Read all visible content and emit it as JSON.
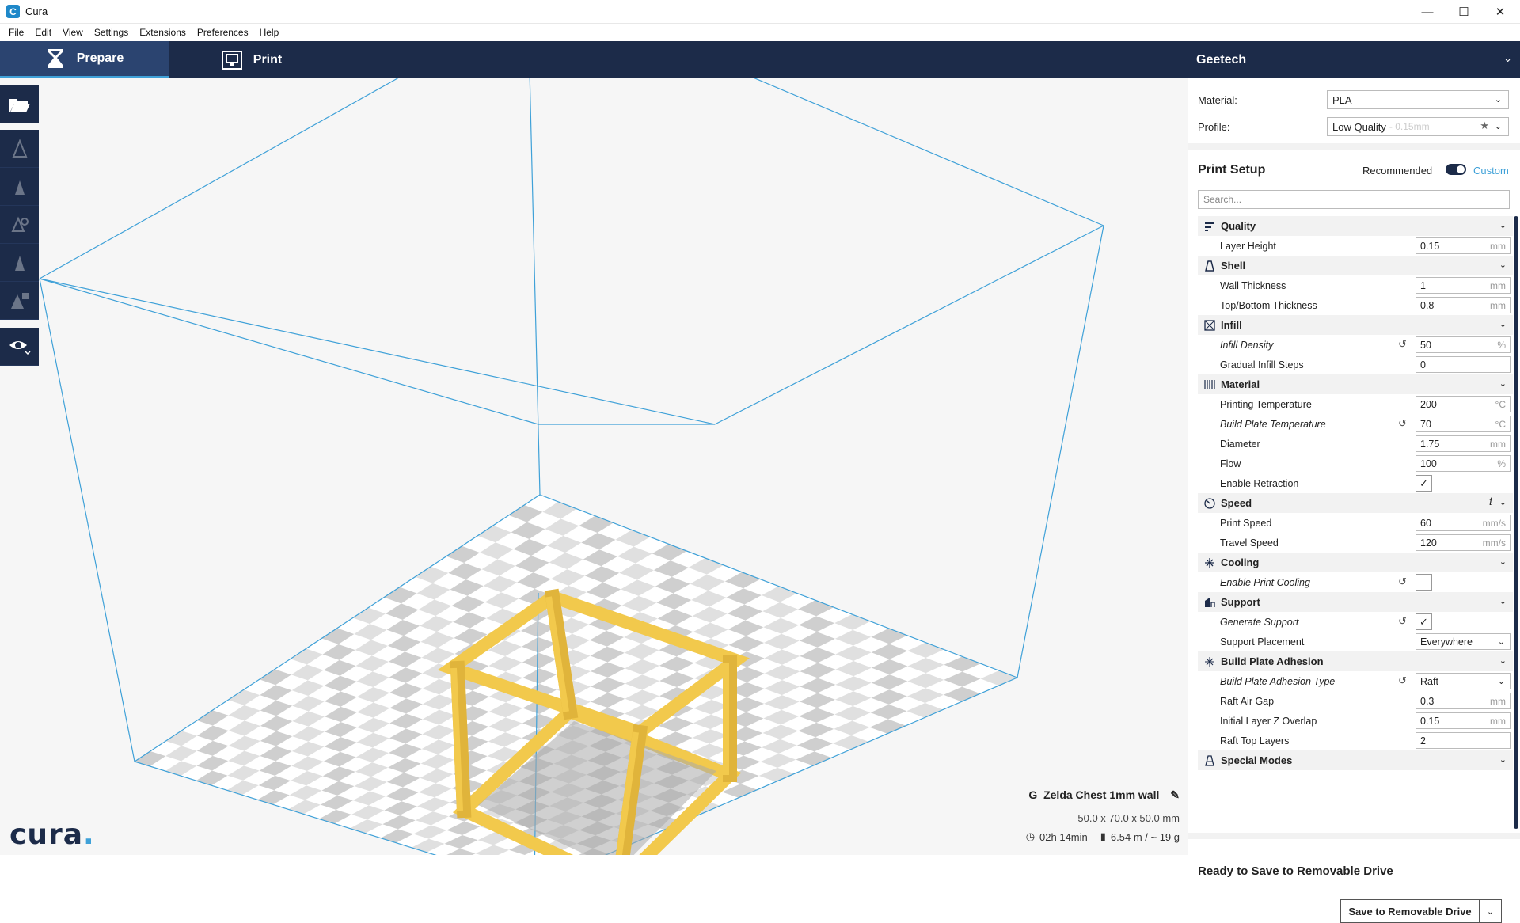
{
  "window": {
    "title": "Cura",
    "app_icon": "C",
    "minimize": "—",
    "maximize": "☐",
    "close": "✕"
  },
  "menu": [
    "File",
    "Edit",
    "View",
    "Settings",
    "Extensions",
    "Preferences",
    "Help"
  ],
  "header": {
    "tabs": [
      {
        "label": "Prepare",
        "icon": "prepare-icon",
        "active": true
      },
      {
        "label": "Print",
        "icon": "print-icon",
        "active": false
      }
    ],
    "machine": "Geetech"
  },
  "toolbar": {
    "buttons": [
      "open-folder-icon",
      "move-icon",
      "scale-icon",
      "rotate-icon",
      "mirror-icon",
      "per-model-settings-icon",
      "view-mode-eye-icon"
    ]
  },
  "viewport": {
    "model_name": "G_Zelda Chest 1mm wall",
    "dimensions": "50.0 x 70.0 x 50.0 mm",
    "print_time": "02h 14min",
    "material_estimate": "6.54 m / ~ 19 g",
    "logo": "cura",
    "logo_dot": "."
  },
  "sidebar": {
    "material_label": "Material:",
    "material_value": "PLA",
    "profile_label": "Profile:",
    "profile_value": "Low Quality",
    "profile_sub": " - 0.15mm",
    "print_setup": "Print Setup",
    "recommended": "Recommended",
    "custom": "Custom",
    "search_placeholder": "Search...",
    "categories": [
      {
        "name": "Quality",
        "icon": "quality-icon",
        "settings": [
          {
            "label": "Layer Height",
            "type": "field",
            "value": "0.15",
            "unit": "mm",
            "modified": false
          }
        ]
      },
      {
        "name": "Shell",
        "icon": "shell-icon",
        "settings": [
          {
            "label": "Wall Thickness",
            "type": "field",
            "value": "1",
            "unit": "mm",
            "modified": false
          },
          {
            "label": "Top/Bottom Thickness",
            "type": "field",
            "value": "0.8",
            "unit": "mm",
            "modified": false
          }
        ]
      },
      {
        "name": "Infill",
        "icon": "infill-icon",
        "settings": [
          {
            "label": "Infill Density",
            "type": "field",
            "value": "50",
            "unit": "%",
            "modified": true
          },
          {
            "label": "Gradual Infill Steps",
            "type": "field",
            "value": "0",
            "unit": "",
            "modified": false
          }
        ]
      },
      {
        "name": "Material",
        "icon": "material-icon",
        "settings": [
          {
            "label": "Printing Temperature",
            "type": "field",
            "value": "200",
            "unit": "°C",
            "modified": false
          },
          {
            "label": "Build Plate Temperature",
            "type": "field",
            "value": "70",
            "unit": "°C",
            "modified": true
          },
          {
            "label": "Diameter",
            "type": "field",
            "value": "1.75",
            "unit": "mm",
            "modified": false
          },
          {
            "label": "Flow",
            "type": "field",
            "value": "100",
            "unit": "%",
            "modified": false
          },
          {
            "label": "Enable Retraction",
            "type": "checkbox",
            "checked": true,
            "modified": false
          }
        ]
      },
      {
        "name": "Speed",
        "icon": "speed-icon",
        "info": "i",
        "settings": [
          {
            "label": "Print Speed",
            "type": "field",
            "value": "60",
            "unit": "mm/s",
            "modified": false
          },
          {
            "label": "Travel Speed",
            "type": "field",
            "value": "120",
            "unit": "mm/s",
            "modified": false
          }
        ]
      },
      {
        "name": "Cooling",
        "icon": "cooling-icon",
        "settings": [
          {
            "label": "Enable Print Cooling",
            "type": "checkbox",
            "checked": false,
            "modified": true
          }
        ]
      },
      {
        "name": "Support",
        "icon": "support-icon",
        "settings": [
          {
            "label": "Generate Support",
            "type": "checkbox",
            "checked": true,
            "modified": true
          },
          {
            "label": "Support Placement",
            "type": "select",
            "value": "Everywhere",
            "modified": false
          }
        ]
      },
      {
        "name": "Build Plate Adhesion",
        "icon": "adhesion-icon",
        "settings": [
          {
            "label": "Build Plate Adhesion Type",
            "type": "select",
            "value": "Raft",
            "modified": true
          },
          {
            "label": "Raft Air Gap",
            "type": "field",
            "value": "0.3",
            "unit": "mm",
            "modified": false
          },
          {
            "label": "Initial Layer Z Overlap",
            "type": "field",
            "value": "0.15",
            "unit": "mm",
            "modified": false
          },
          {
            "label": "Raft Top Layers",
            "type": "field",
            "value": "2",
            "unit": "",
            "modified": false
          }
        ]
      },
      {
        "name": "Special Modes",
        "icon": "special-modes-icon",
        "settings": []
      }
    ],
    "status": "Ready to Save to Removable Drive",
    "save_button": "Save to Removable Drive"
  },
  "colors": {
    "header_bg": "#1c2b49",
    "active_tab": "#2b4470",
    "accent": "#3fa1d8",
    "model": "#f2c94c"
  }
}
